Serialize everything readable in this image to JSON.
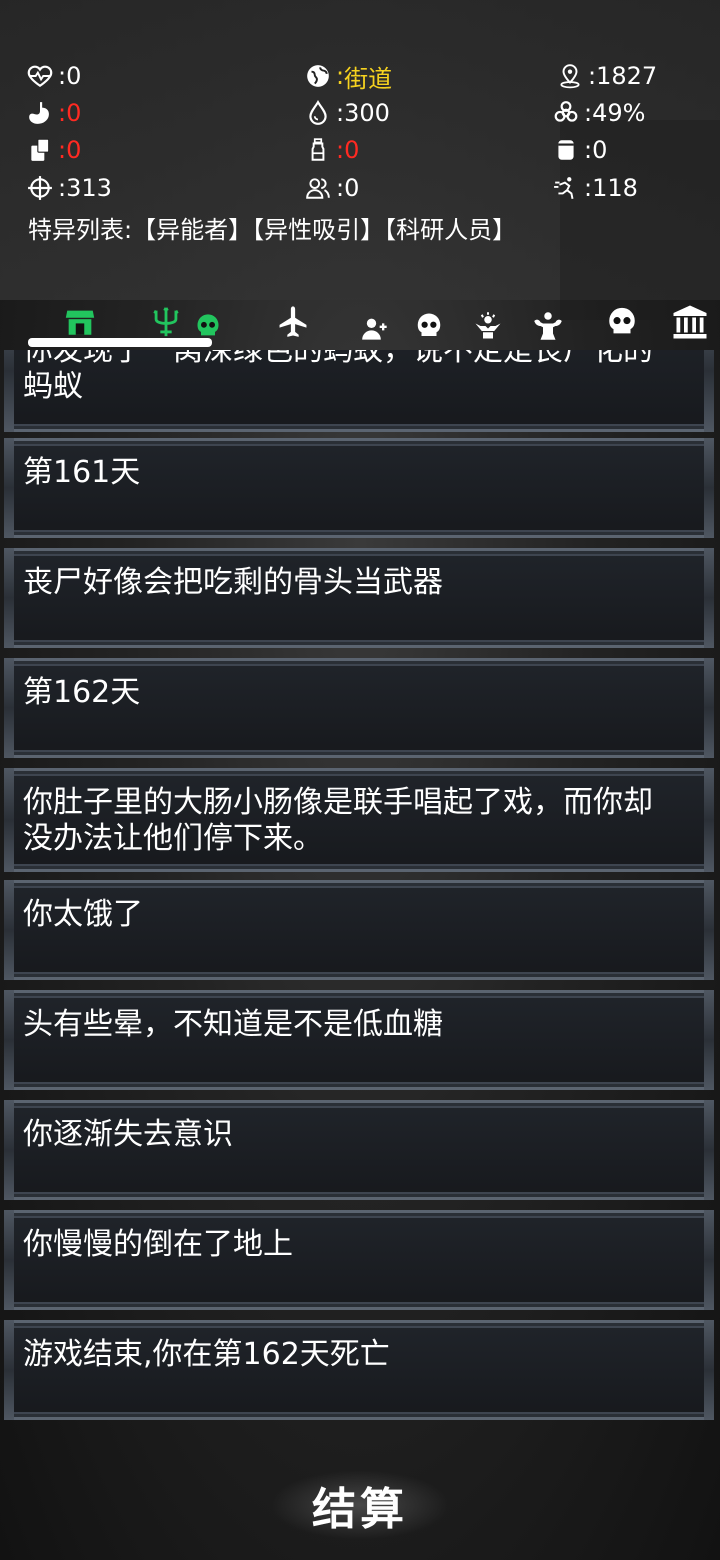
{
  "stats": {
    "health": "0",
    "location": "街道",
    "distance": "1827",
    "hunger": "0",
    "water": "300",
    "infection": "49%",
    "food_item": "0",
    "bottle": "0",
    "jar": "0",
    "aim": "313",
    "survivors": "0",
    "speed": "118"
  },
  "separator": ":",
  "specials": {
    "label": "特异列表:",
    "traits": "【异能者】【异性吸引】【科研人员】"
  },
  "tabs": [
    {
      "name": "shop-icon",
      "color": "#22c55e"
    },
    {
      "name": "trident-icon",
      "color": "#22c55e"
    },
    {
      "name": "skull-icon",
      "color": "#22c55e"
    },
    {
      "name": "airplane-icon",
      "color": "#ffffff"
    },
    {
      "name": "add-person-icon",
      "color": "#ffffff"
    },
    {
      "name": "skull-icon",
      "color": "#ffffff"
    },
    {
      "name": "hand-sun-icon",
      "color": "#ffffff"
    },
    {
      "name": "muscle-icon",
      "color": "#ffffff"
    },
    {
      "name": "skull-icon",
      "color": "#ffffff"
    },
    {
      "name": "bank-icon",
      "color": "#ffffff"
    }
  ],
  "log": [
    "你发现了一窝深绿色的蚂蚁，说不定是丧尸化的蚂蚁",
    "第161天",
    "丧尸好像会把吃剩的骨头当武器",
    "第162天",
    "你肚子里的大肠小肠像是联手唱起了戏，而你却没办法让他们停下来。",
    "你太饿了",
    "头有些晕，不知道是不是低血糖",
    "你逐渐失去意识",
    "你慢慢的倒在了地上",
    "游戏结束,你在第162天死亡"
  ],
  "settle_button": "结算",
  "colors": {
    "highlight": "#f6d21f",
    "danger": "#ff2a22",
    "active_tab": "#22c55e"
  }
}
